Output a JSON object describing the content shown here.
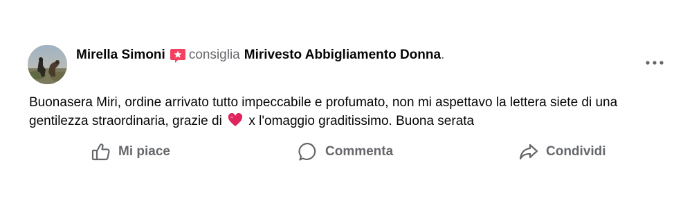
{
  "post": {
    "author": "Mirella Simoni",
    "recommend_verb": "consiglia",
    "page_name": "Mirivesto Abbigliamento Donna",
    "period": ".",
    "more_label": "•••",
    "text_part1": "Buonasera Miri, ordine arrivato tutto impeccabile e profumato, non mi aspettavo la lettera siete di una gentilezza straordinaria, grazie di",
    "text_part2": "x l'omaggio graditissimo. Buona serata"
  },
  "actions": {
    "like_label": "Mi piace",
    "comment_label": "Commenta",
    "share_label": "Condividi"
  },
  "colors": {
    "secondary_text": "#65676b",
    "primary_text": "#050505",
    "recommend_badge": "#f3425f",
    "heart": "#e0245e"
  },
  "icons": {
    "recommend": "recommendation-star-icon",
    "heart": "red-heart-emoji",
    "like": "thumbs-up-icon",
    "comment": "speech-bubble-icon",
    "share": "share-arrow-icon",
    "more": "ellipsis-icon"
  }
}
